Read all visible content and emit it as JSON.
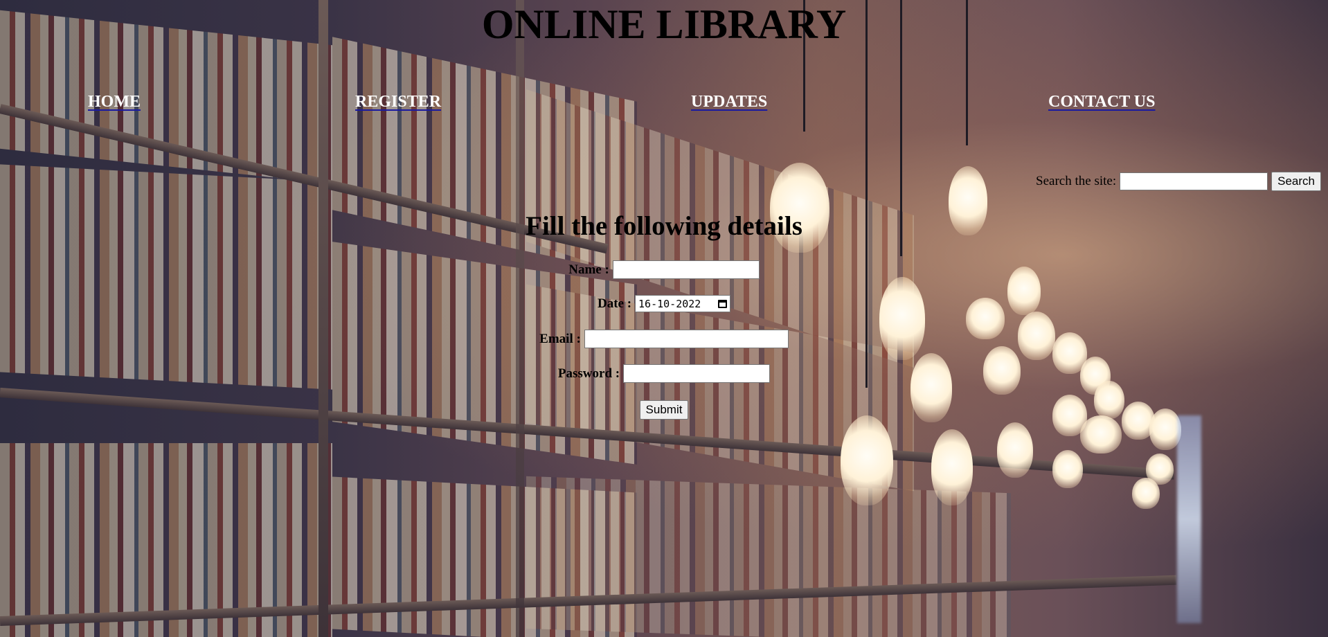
{
  "header": {
    "title": "ONLINE LIBRARY"
  },
  "nav": {
    "items": [
      {
        "label": "HOME"
      },
      {
        "label": "REGISTER"
      },
      {
        "label": "UPDATES"
      },
      {
        "label": "CONTACT US"
      }
    ]
  },
  "search": {
    "label": "Search the site:",
    "value": "",
    "button_label": "Search"
  },
  "form": {
    "heading": "Fill the following details",
    "name_label": "Name :",
    "name_value": "",
    "date_label": "Date :",
    "date_value": "16-10-2022",
    "email_label": "Email :",
    "email_value": "",
    "password_label": "Password :",
    "password_value": "",
    "submit_label": "Submit"
  },
  "icons": {
    "date_picker": "calendar-icon"
  }
}
